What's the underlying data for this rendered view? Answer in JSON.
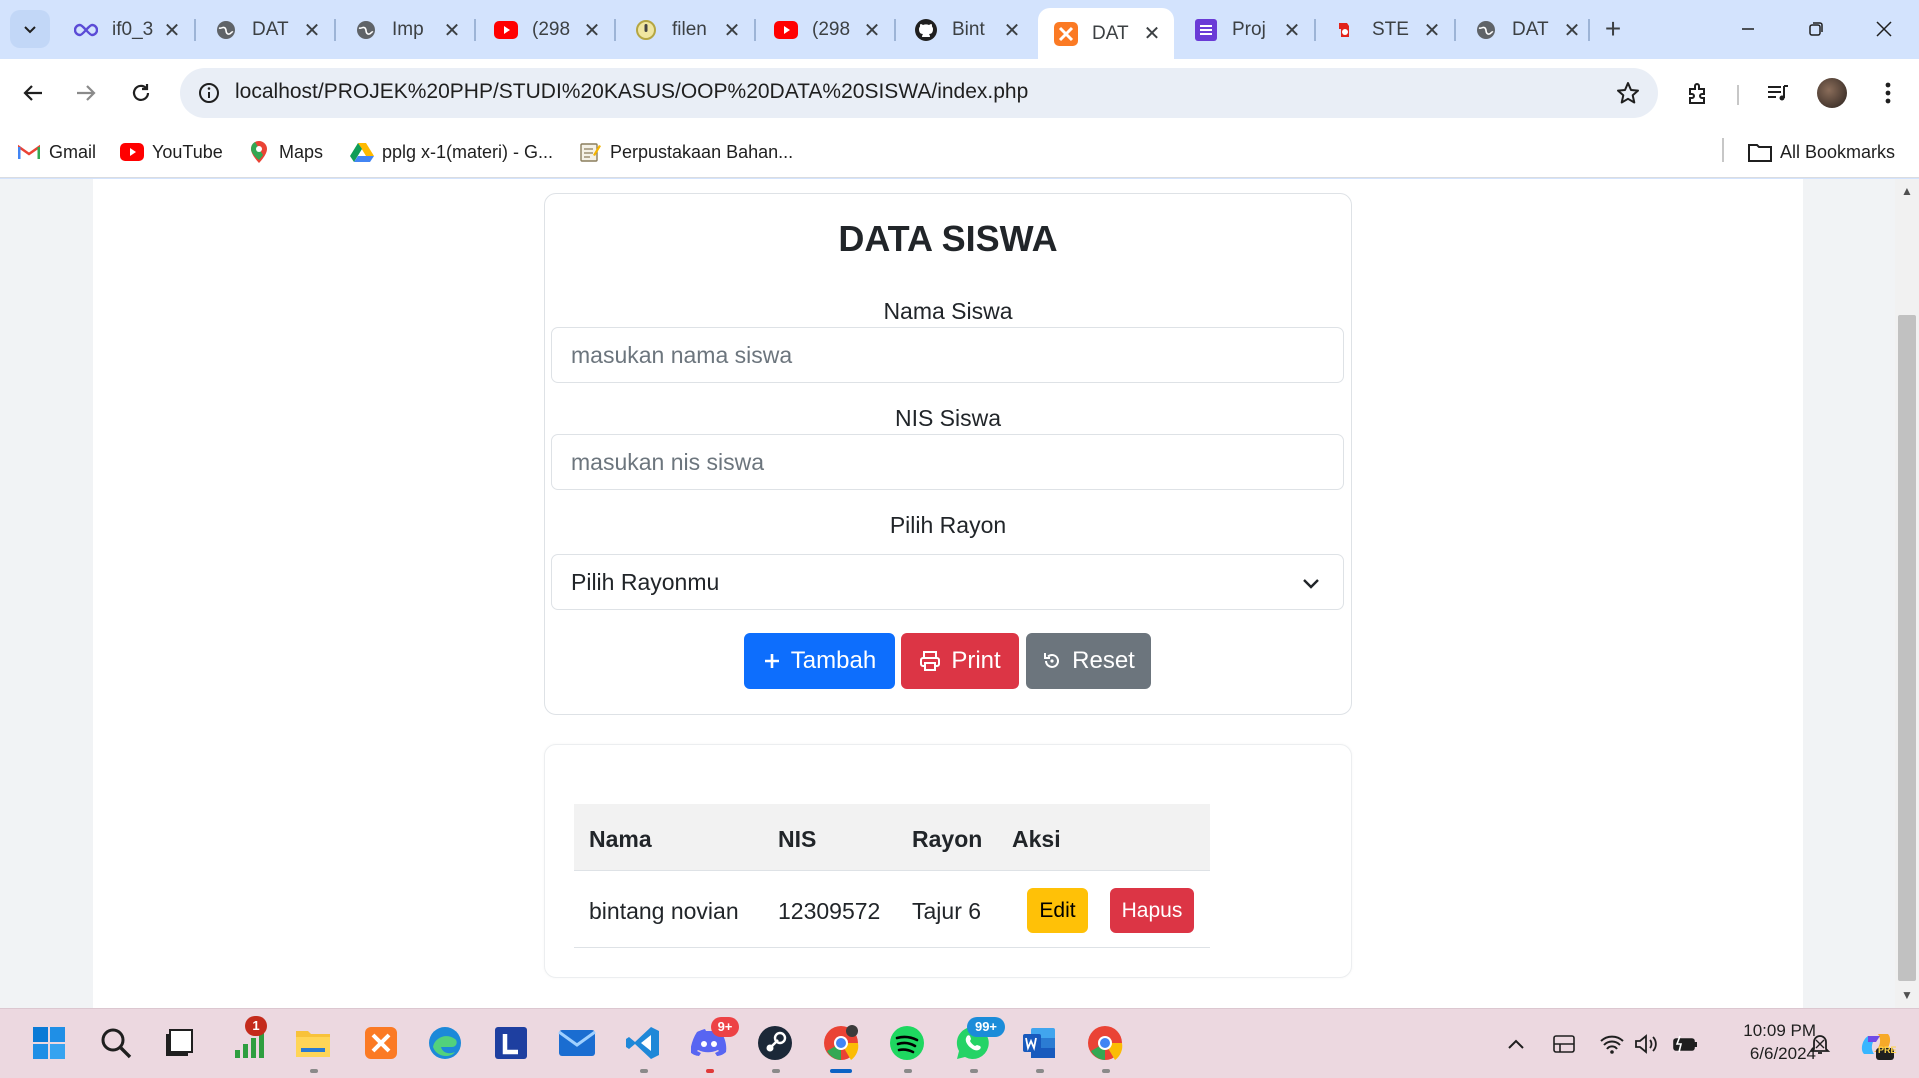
{
  "browser": {
    "tabs": [
      {
        "title": "if0_3",
        "icon": "infinity-icon"
      },
      {
        "title": "DAT",
        "icon": "globe-icon"
      },
      {
        "title": "Imp",
        "icon": "globe-icon"
      },
      {
        "title": "(298",
        "icon": "youtube-icon"
      },
      {
        "title": "filen",
        "icon": "yellow-circle-icon"
      },
      {
        "title": "(298",
        "icon": "youtube-icon"
      },
      {
        "title": "Bint",
        "icon": "github-icon"
      },
      {
        "title": "DAT",
        "icon": "xampp-icon",
        "active": true
      },
      {
        "title": "Proj",
        "icon": "list-icon"
      },
      {
        "title": "STE",
        "icon": "steam-icon"
      },
      {
        "title": "DAT",
        "icon": "globe-icon"
      }
    ],
    "url": "localhost/PROJEK%20PHP/STUDI%20KASUS/OOP%20DATA%20SISWA/index.php",
    "bookmarks": [
      {
        "label": "Gmail",
        "icon": "gmail-icon"
      },
      {
        "label": "YouTube",
        "icon": "youtube-icon"
      },
      {
        "label": "Maps",
        "icon": "maps-icon"
      },
      {
        "label": "pplg x-1(materi) - G...",
        "icon": "drive-icon"
      },
      {
        "label": "Perpustakaan Bahan...",
        "icon": "notepad-icon"
      }
    ],
    "all_bookmarks": "All Bookmarks"
  },
  "form": {
    "title": "DATA SISWA",
    "nama_label": "Nama Siswa",
    "nama_placeholder": "masukan nama siswa",
    "nis_label": "NIS Siswa",
    "nis_placeholder": "masukan nis siswa",
    "rayon_label": "Pilih Rayon",
    "rayon_selected": "Pilih Rayonmu",
    "btn_tambah": "Tambah",
    "btn_print": "Print",
    "btn_reset": "Reset"
  },
  "table": {
    "headers": [
      "Nama",
      "NIS",
      "Rayon",
      "Aksi"
    ],
    "rows": [
      {
        "nama": "bintang novian",
        "nis": "12309572",
        "rayon": "Tajur 6",
        "edit": "Edit",
        "hapus": "Hapus"
      }
    ]
  },
  "taskbar": {
    "badges": {
      "stats": "1",
      "discord": "9+",
      "whatsapp": "99+"
    },
    "time": "10:09 PM",
    "date": "6/6/2024",
    "copilot_badge": "PRE"
  },
  "colors": {
    "primary": "#0d6efd",
    "danger": "#dc3545",
    "secondary": "#6c757d",
    "warning": "#ffc107"
  }
}
